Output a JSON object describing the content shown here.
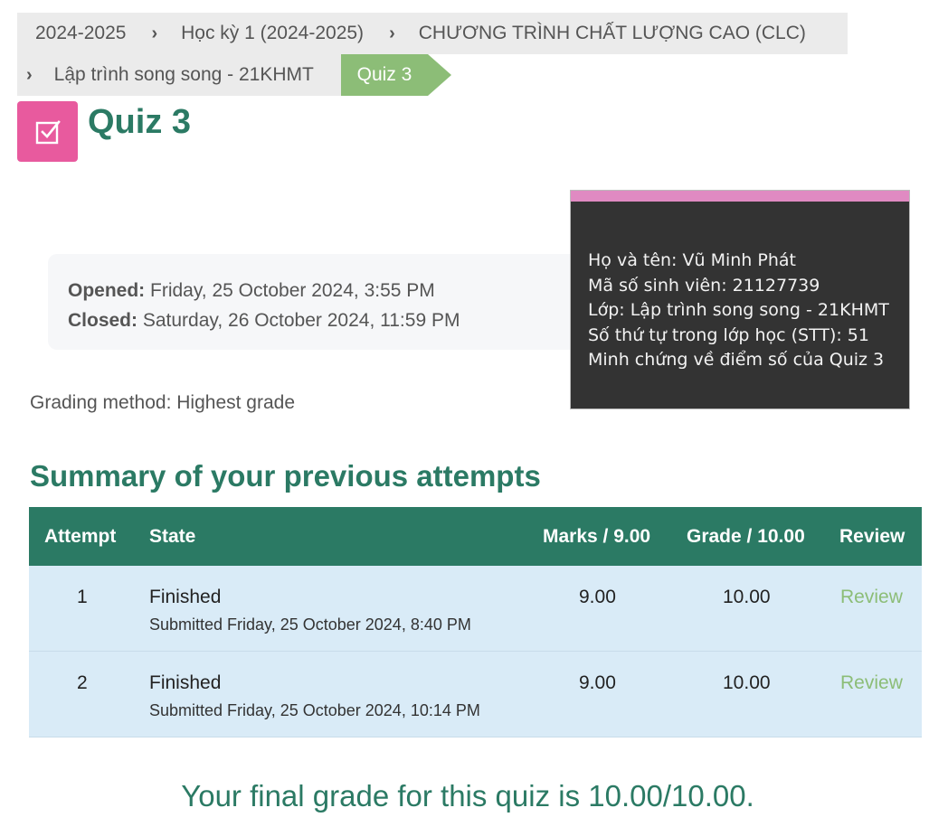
{
  "breadcrumb": {
    "items": [
      "2024-2025",
      "Học kỳ 1 (2024-2025)",
      "CHƯƠNG TRÌNH CHẤT LƯỢNG CAO (CLC)",
      "Lập trình song song - 21KHMT"
    ],
    "active": "Quiz 3",
    "separator": "›"
  },
  "page": {
    "title": "Quiz 3",
    "icon": "quiz-checkbox-icon"
  },
  "dates": {
    "opened_label": "Opened:",
    "opened_value": "Friday, 25 October 2024, 3:55 PM",
    "closed_label": "Closed:",
    "closed_value": "Saturday, 26 October 2024, 11:59 PM"
  },
  "note": {
    "lines": [
      "Họ và tên: Vũ Minh Phát",
      "Mã số sinh viên: 21127739",
      "Lớp: Lập trình song song - 21KHMT",
      "Số thứ tự trong lớp học (STT): 51",
      "Minh chứng về điểm số của Quiz 3"
    ]
  },
  "grading_method": "Grading method: Highest grade",
  "summary": {
    "heading": "Summary of your previous attempts",
    "headers": [
      "Attempt",
      "State",
      "Marks / 9.00",
      "Grade / 10.00",
      "Review"
    ],
    "rows": [
      {
        "attempt": "1",
        "state": "Finished",
        "submitted": "Submitted Friday, 25 October 2024, 8:40 PM",
        "marks": "9.00",
        "grade": "10.00",
        "review": "Review"
      },
      {
        "attempt": "2",
        "state": "Finished",
        "submitted": "Submitted Friday, 25 October 2024, 10:14 PM",
        "marks": "9.00",
        "grade": "10.00",
        "review": "Review"
      }
    ]
  },
  "final_grade": "Your final grade for this quiz is 10.00/10.00.",
  "colors": {
    "primary": "#2b7a64",
    "breadcrumb_active": "#8cbd77",
    "quiz_icon_bg": "#e85a9e",
    "row_bg": "#d9ebf7",
    "review_link": "#8cbd77"
  }
}
